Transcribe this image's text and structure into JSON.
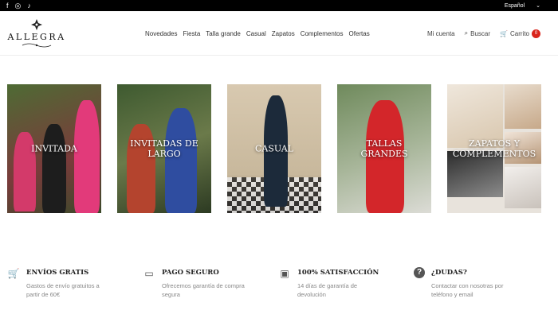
{
  "topbar": {
    "social": [
      {
        "icon": "facebook-icon",
        "glyph": "f"
      },
      {
        "icon": "instagram-icon",
        "glyph": "◎"
      },
      {
        "icon": "tiktok-icon",
        "glyph": "♪"
      }
    ],
    "language": "Español"
  },
  "header": {
    "logo_text": "ALLEGRA",
    "nav": [
      "Novedades",
      "Fiesta",
      "Talla grande",
      "Casual",
      "Zapatos",
      "Complementos",
      "Ofertas"
    ],
    "account_label": "Mi cuenta",
    "search_label": "Buscar",
    "cart_label": "Carrito",
    "cart_count": "0"
  },
  "categories": [
    {
      "label": "INVITADA",
      "bg": "#5b6e3a"
    },
    {
      "label": "INVITADAS DE LARGO",
      "bg": "#4a5a35"
    },
    {
      "label": "CASUAL",
      "bg": "#b8a58c"
    },
    {
      "label": "TALLAS GRANDES",
      "bg": "#8fa17c"
    },
    {
      "label": "ZAPATOS Y COMPLEMENTOS",
      "bg": "#e2dcd5"
    }
  ],
  "features": [
    {
      "icon": "cart-icon",
      "glyph": "🛒",
      "title": "ENVÍOS GRATIS",
      "text": "Gastos de envío gratuitos a partir de 60€"
    },
    {
      "icon": "credit-card-icon",
      "glyph": "▭",
      "title": "PAGO SEGURO",
      "text": "Ofrecemos garantía de compra segura"
    },
    {
      "icon": "wallet-icon",
      "glyph": "▣",
      "title": "100% SATISFACCIÓN",
      "text": "14 días de garantía de devolución"
    },
    {
      "icon": "question-icon",
      "glyph": "?",
      "title": "¿DUDAS?",
      "text": "Contactar con nosotras por teléfono y email"
    }
  ]
}
